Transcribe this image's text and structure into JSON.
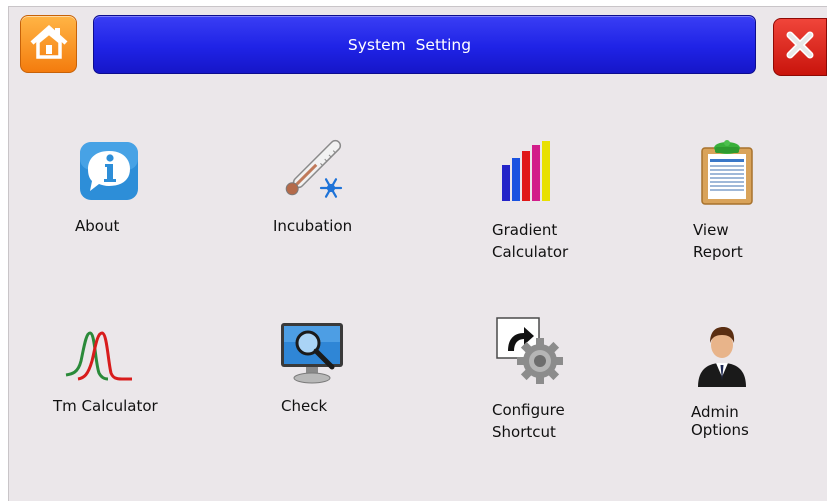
{
  "header": {
    "title": "System  Setting",
    "home_icon": "home-icon",
    "close_icon": "close-icon"
  },
  "tiles": [
    {
      "line1": "About",
      "line2": "",
      "icon": "info-icon"
    },
    {
      "line1": "Incubation",
      "line2": "",
      "icon": "thermometer-snowflake-icon"
    },
    {
      "line1": "Gradient",
      "line2": "Calculator",
      "icon": "gradient-bars-icon"
    },
    {
      "line1": "View",
      "line2": "Report",
      "icon": "clipboard-report-icon"
    },
    {
      "line1": "Tm Calculator",
      "line2": "",
      "icon": "melt-curve-icon"
    },
    {
      "line1": "Check",
      "line2": "",
      "icon": "monitor-magnifier-icon"
    },
    {
      "line1": "Configure",
      "line2": "Shortcut",
      "icon": "shortcut-gear-icon"
    },
    {
      "line1": "Admin",
      "line2": "Options",
      "icon": "admin-user-icon"
    }
  ],
  "colors": {
    "background": "#ebe7ea",
    "title_bar": "#1f23e6",
    "home_button": "#f4900e",
    "close_button": "#d81c12"
  }
}
